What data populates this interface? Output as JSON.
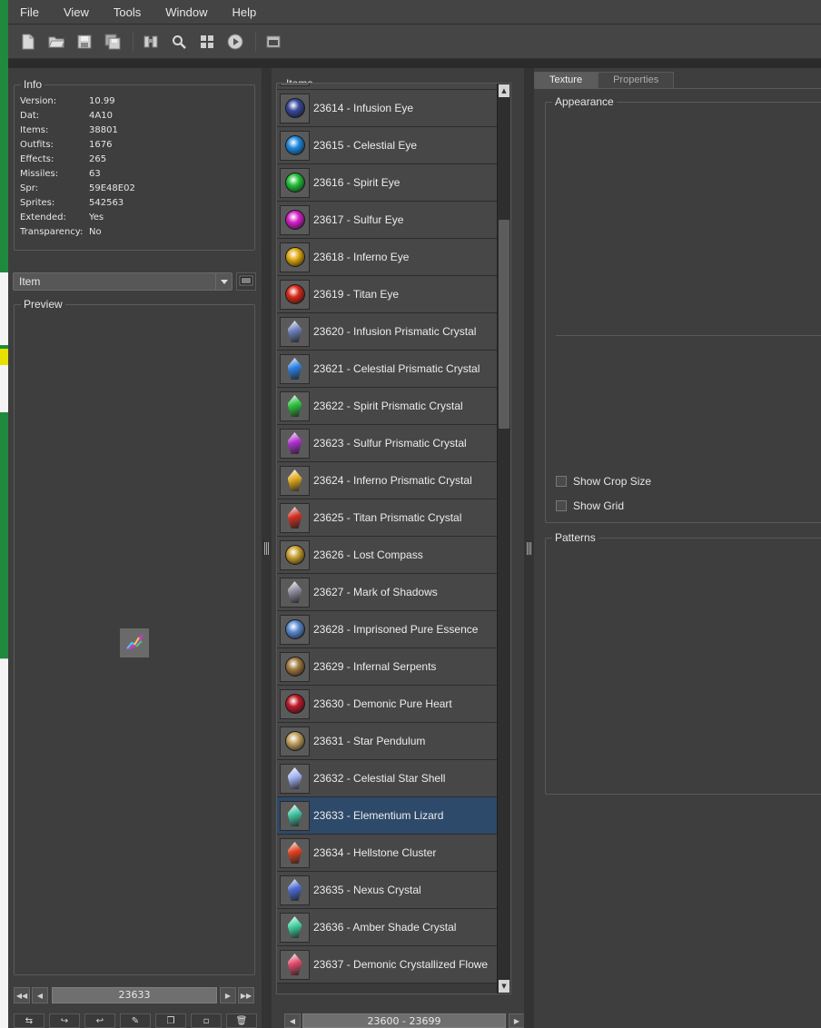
{
  "menu": [
    "File",
    "View",
    "Tools",
    "Window",
    "Help"
  ],
  "toolbar": {
    "icons": [
      "new-file-icon",
      "open-folder-icon",
      "save-icon",
      "save-all-icon",
      "compile-icon",
      "find-icon",
      "sprite-grid-icon",
      "play-animation-icon",
      "terminal-icon"
    ]
  },
  "info": {
    "title": "Info",
    "rows": [
      {
        "key": "Version:",
        "value": "10.99"
      },
      {
        "key": "Dat:",
        "value": "4A10"
      },
      {
        "key": "Items:",
        "value": "38801"
      },
      {
        "key": "Outfits:",
        "value": "1676"
      },
      {
        "key": "Effects:",
        "value": "265"
      },
      {
        "key": "Missiles:",
        "value": "63"
      },
      {
        "key": "Spr:",
        "value": "59E48E02"
      },
      {
        "key": "Sprites:",
        "value": "542563"
      },
      {
        "key": "Extended:",
        "value": "Yes"
      },
      {
        "key": "Transparency:",
        "value": "No"
      }
    ]
  },
  "category_select": {
    "value": "Item"
  },
  "preview": {
    "title": "Preview",
    "current_id": "23633"
  },
  "items_panel": {
    "title": "Items",
    "range": "23600 - 23699",
    "items": [
      {
        "label": "23614 - Infusion Eye",
        "kind": "gem",
        "color": "#3a4a9a"
      },
      {
        "label": "23615 - Celestial Eye",
        "kind": "gem",
        "color": "#1e8ae0"
      },
      {
        "label": "23616 - Spirit Eye",
        "kind": "gem",
        "color": "#22c23a"
      },
      {
        "label": "23617 - Sulfur Eye",
        "kind": "gem",
        "color": "#d620c8"
      },
      {
        "label": "23618 - Inferno Eye",
        "kind": "gem",
        "color": "#e0a810"
      },
      {
        "label": "23619 - Titan Eye",
        "kind": "gem",
        "color": "#d82a1a"
      },
      {
        "label": "23620 - Infusion Prismatic Crystal",
        "kind": "crystal",
        "color": "#6c7fb8"
      },
      {
        "label": "23621 - Celestial Prismatic Crystal",
        "kind": "crystal",
        "color": "#2c7fe0"
      },
      {
        "label": "23622 - Spirit Prismatic Crystal",
        "kind": "crystal",
        "color": "#2ac23e"
      },
      {
        "label": "23623 - Sulfur Prismatic Crystal",
        "kind": "crystal",
        "color": "#b030d0"
      },
      {
        "label": "23624 - Inferno Prismatic Crystal",
        "kind": "crystal",
        "color": "#e0a820"
      },
      {
        "label": "23625 - Titan Prismatic Crystal",
        "kind": "crystal",
        "color": "#d03020"
      },
      {
        "label": "23626 - Lost Compass",
        "kind": "gem",
        "color": "#c8a030"
      },
      {
        "label": "23627 - Mark of Shadows",
        "kind": "crystal",
        "color": "#8a8a9a"
      },
      {
        "label": "23628 - Imprisoned Pure Essence",
        "kind": "gem",
        "color": "#5a8ad0"
      },
      {
        "label": "23629 - Infernal Serpents",
        "kind": "gem",
        "color": "#a07a40"
      },
      {
        "label": "23630 - Demonic Pure Heart",
        "kind": "gem",
        "color": "#c01a2a"
      },
      {
        "label": "23631 - Star Pendulum",
        "kind": "gem",
        "color": "#c0a060"
      },
      {
        "label": "23632 - Celestial Star Shell",
        "kind": "crystal",
        "color": "#a0b0f0"
      },
      {
        "label": "23633 - Elementium Lizard",
        "kind": "crystal",
        "color": "#40c0a0"
      },
      {
        "label": "23634 - Hellstone Cluster",
        "kind": "crystal",
        "color": "#e04020"
      },
      {
        "label": "23635 - Nexus Crystal",
        "kind": "crystal",
        "color": "#4a6ad0"
      },
      {
        "label": "23636 - Amber Shade Crystal",
        "kind": "crystal",
        "color": "#40d0a0"
      },
      {
        "label": "23637 - Demonic Crystallized Flowe",
        "kind": "crystal",
        "color": "#e04a6a"
      }
    ],
    "selected_index": 19
  },
  "tabs": [
    "Texture",
    "Properties"
  ],
  "appearance": {
    "title": "Appearance",
    "show_crop_size": "Show Crop Size",
    "show_grid": "Show Grid"
  },
  "patterns": {
    "title": "Patterns"
  }
}
